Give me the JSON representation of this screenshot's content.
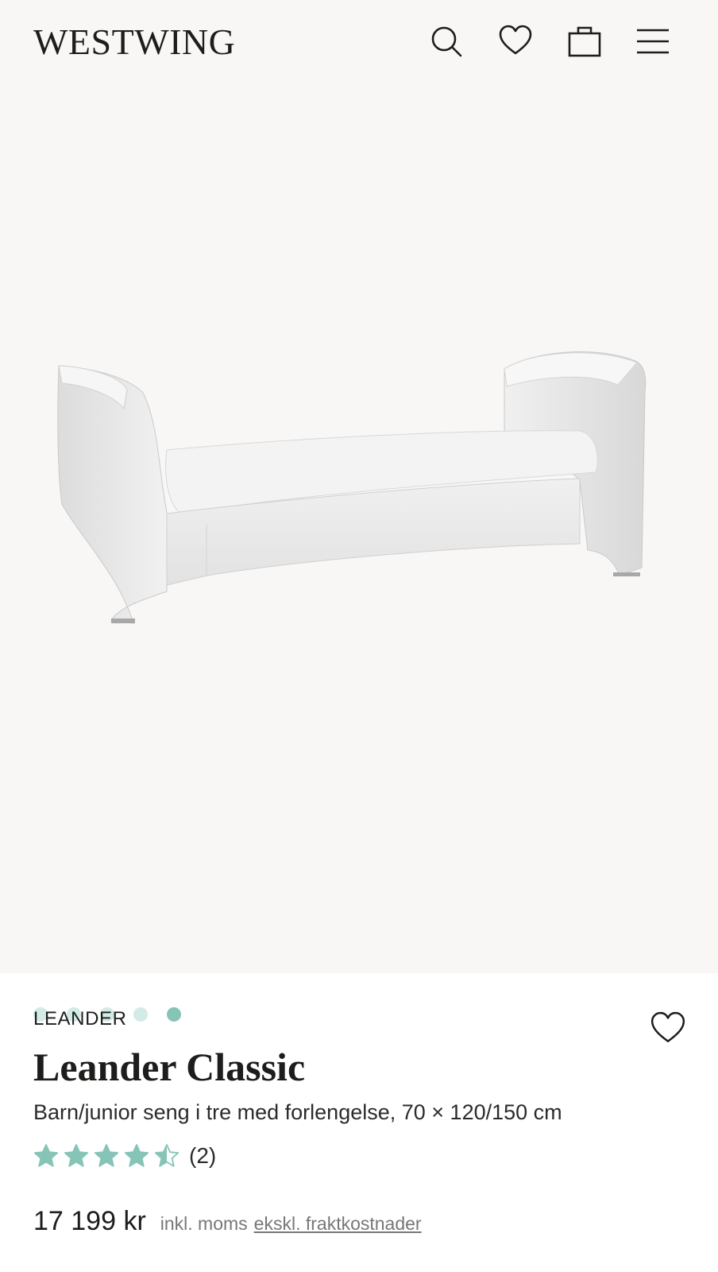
{
  "header": {
    "logo": "WESTWING",
    "icons": [
      "search-icon",
      "heart-icon",
      "bag-icon",
      "menu-icon"
    ]
  },
  "gallery": {
    "image_count": 5,
    "active_index": 4
  },
  "product": {
    "brand": "LEANDER",
    "title": "Leander Classic",
    "subtitle": "Barn/junior seng i tre med forlengelse, 70 × 120/150 cm",
    "rating": 4.5,
    "rating_max": 5,
    "review_count_label": "(2)",
    "price": "17 199 kr",
    "vat_note": "inkl. moms",
    "shipping_note": "ekskl. fraktkostnader"
  },
  "colors": {
    "accent": "#86c4b7",
    "accent_light": "#d3ebe6",
    "background": "#f8f7f6",
    "text": "#1d1d1b"
  }
}
